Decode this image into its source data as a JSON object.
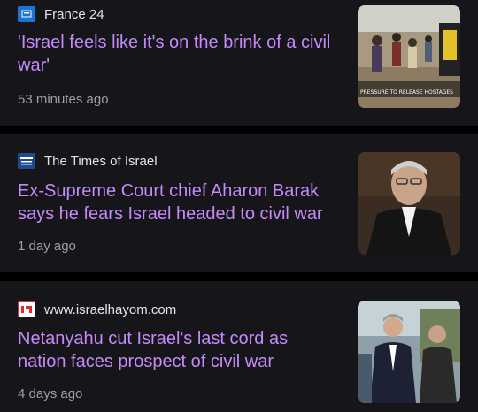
{
  "articles": [
    {
      "source": "France 24",
      "logo": "france24-logo",
      "headline": "'Israel feels like it's on the brink of a civil war'",
      "time": "53 minutes ago",
      "thumbnail": "crowd-walking-photo",
      "thumbnail_caption": "PRESSURE TO RELEASE HOSTAGES"
    },
    {
      "source": "The Times of Israel",
      "logo": "times-of-israel-logo",
      "headline": "Ex-Supreme Court chief Aharon Barak says he fears Israel headed to civil war",
      "time": "1 day ago",
      "thumbnail": "judge-portrait-photo"
    },
    {
      "source": "www.israelhayom.com",
      "logo": "israel-hayom-logo",
      "headline": "Netanyahu cut Israel's last cord as nation faces prospect of civil war",
      "time": "4 days ago",
      "thumbnail": "politicians-photo"
    }
  ],
  "colors": {
    "background": "#000000",
    "card": "#15151a",
    "headline": "#c58af9",
    "source_text": "#e4e4e8",
    "time_text": "#9aa0a6"
  }
}
